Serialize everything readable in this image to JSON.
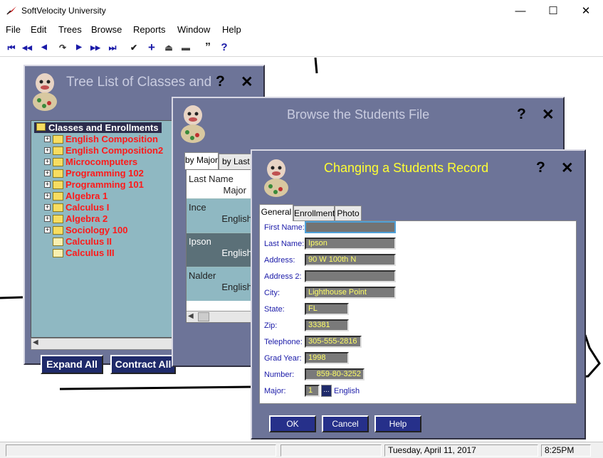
{
  "app": {
    "title": "SoftVelocity University"
  },
  "window_controls": {
    "minimize": "—",
    "maximize": "☐",
    "close": "✕"
  },
  "menu": [
    "File",
    "Edit",
    "Trees",
    "Browse",
    "Reports",
    "Window",
    "Help"
  ],
  "toolbar": {
    "first": "⏮",
    "prev_page": "◀◀",
    "prev": "◀",
    "change": "↷",
    "next": "▶",
    "next_page": "▶▶",
    "last": "⏭",
    "select": "✔",
    "insert": "+",
    "eject": "⏏",
    "delete": "▬",
    "quote": "”",
    "help": "?"
  },
  "tree_window": {
    "title": "Tree List of Classes and",
    "root": "Classes and Enrollments",
    "items": [
      {
        "label": "English Composition",
        "expandable": true
      },
      {
        "label": "English Composition2",
        "expandable": true
      },
      {
        "label": "Microcomputers",
        "expandable": true
      },
      {
        "label": "Programming 102",
        "expandable": true
      },
      {
        "label": "Programming 101",
        "expandable": true
      },
      {
        "label": "Algebra 1",
        "expandable": true
      },
      {
        "label": "Calculus I",
        "expandable": true
      },
      {
        "label": "Algebra 2",
        "expandable": true
      },
      {
        "label": "Sociology 100",
        "expandable": true
      },
      {
        "label": "Calculus II",
        "expandable": false
      },
      {
        "label": "Calculus III",
        "expandable": false
      }
    ],
    "expand_all": "Expand All",
    "contract_all": "Contract All",
    "help_symbol": "?",
    "close_symbol": "✕"
  },
  "browse_window": {
    "title": "Browse the Students File",
    "tabs": [
      "by Major",
      "by Last N"
    ],
    "header_line1": "Last Name",
    "header_line2": "Major",
    "rows": [
      {
        "name": "Ince",
        "major": "English"
      },
      {
        "name": "Ipson",
        "major": "English"
      },
      {
        "name": "Nalder",
        "major": "English"
      }
    ],
    "help_symbol": "?",
    "close_symbol": "✕"
  },
  "form_window": {
    "title": "Changing a Students Record",
    "tabs": [
      "General",
      "Enrollment",
      "Photo"
    ],
    "fields": {
      "first_name": {
        "label": "First Name:",
        "value": ""
      },
      "last_name": {
        "label": "Last Name:",
        "value": "Ipson"
      },
      "address": {
        "label": "Address:",
        "value": "90 W 100th N"
      },
      "address2": {
        "label": "Address 2:",
        "value": ""
      },
      "city": {
        "label": "City:",
        "value": "Lighthouse Point"
      },
      "state": {
        "label": "State:",
        "value": "FL"
      },
      "zip": {
        "label": "Zip:",
        "value": "33381"
      },
      "telephone": {
        "label": "Telephone:",
        "value": "305-555-2816"
      },
      "grad_year": {
        "label": "Grad Year:",
        "value": "1998"
      },
      "number": {
        "label": "Number:",
        "value": "859-80-3252"
      },
      "major": {
        "label": "Major:",
        "value": "1",
        "lookup": "...",
        "description": "English"
      }
    },
    "ok": "OK",
    "cancel": "Cancel",
    "help": "Help",
    "help_symbol": "?",
    "close_symbol": "✕"
  },
  "status": {
    "date": "Tuesday, April 11, 2017",
    "time": "8:25PM"
  },
  "colors": {
    "panel": "#6d7498",
    "tree_bg": "#8fb8c2",
    "tree_text": "#ff1a1a",
    "field_text": "#ffff66",
    "label_text": "#1a1aa8",
    "form_title": "#ffff33"
  }
}
